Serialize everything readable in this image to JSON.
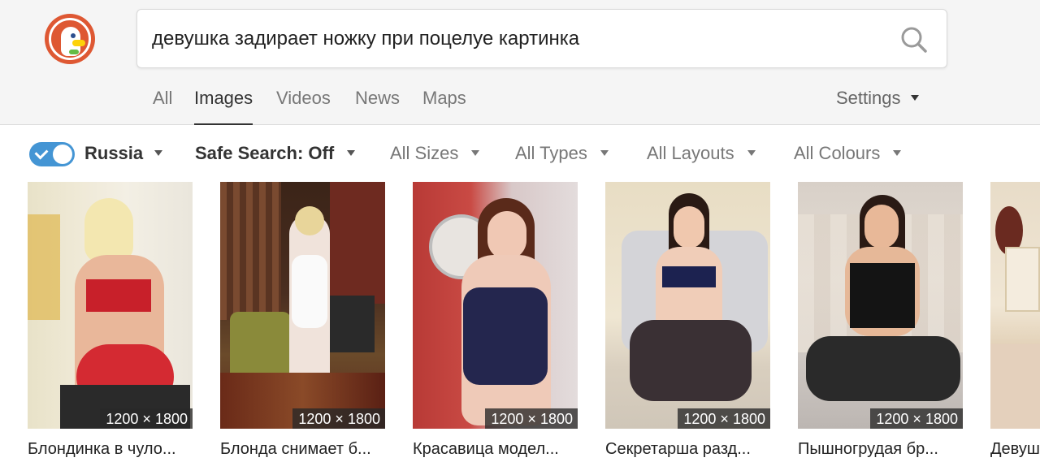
{
  "search": {
    "query": "девушка задирает ножку при поцелуе картинка"
  },
  "nav": {
    "tabs": [
      "All",
      "Images",
      "Videos",
      "News",
      "Maps"
    ],
    "active": "Images",
    "settings_label": "Settings"
  },
  "filters": {
    "region_label": "Russia",
    "region_enabled": true,
    "safe_search_label": "Safe Search: Off",
    "sizes_label": "All Sizes",
    "types_label": "All Types",
    "layouts_label": "All Layouts",
    "colours_label": "All Colours"
  },
  "results": [
    {
      "title": "Блондинка в чуло...",
      "dims": "1200 × 1800"
    },
    {
      "title": "Блонда снимает б...",
      "dims": "1200 × 1800"
    },
    {
      "title": "Красавица модел...",
      "dims": "1200 × 1800"
    },
    {
      "title": "Секретарша разд...",
      "dims": "1200 × 1800"
    },
    {
      "title": "Пышногрудая бр...",
      "dims": "1200 × 1800"
    },
    {
      "title": "Девуш"
    }
  ],
  "colors": {
    "accent": "#4495d4",
    "brand": "#de5833"
  }
}
